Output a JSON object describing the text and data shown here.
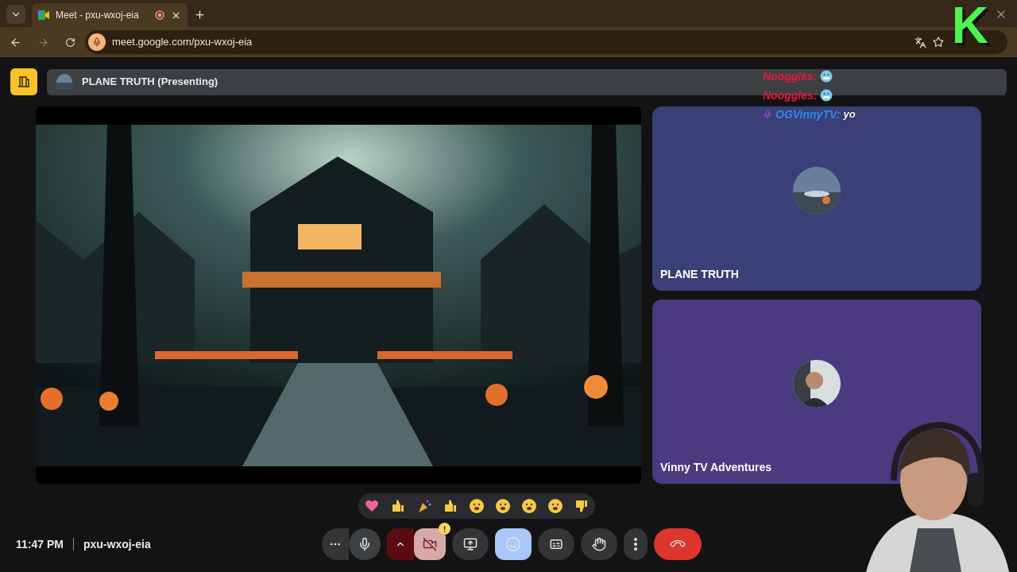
{
  "browser": {
    "tab": {
      "title": "Meet - pxu-wxoj-eia",
      "recording": true
    },
    "url": "meet.google.com/pxu-wxoj-eia"
  },
  "meeting": {
    "presenter_label": "PLANE TRUTH (Presenting)"
  },
  "tiles": [
    {
      "name": "PLANE TRUTH"
    },
    {
      "name": "Vinny TV Adventures"
    }
  ],
  "controls": {
    "camera": {
      "on": false,
      "warning": true
    },
    "reactions": {
      "selected": true
    }
  },
  "footer": {
    "clock": "11:47 PM",
    "meeting_code": "pxu-wxoj-eia"
  },
  "stream_overlay": {
    "logo": "K",
    "chat": [
      {
        "user": "Nooggles:",
        "color": "#e8173f",
        "kind": "emoji",
        "mic_badge": false
      },
      {
        "user": "Nooggles:",
        "color": "#e8173f",
        "kind": "emoji",
        "mic_badge": false
      },
      {
        "user": "OGVinnyTV:",
        "color": "#2f86f0",
        "kind": "text",
        "message": "yo",
        "mic_badge": true
      }
    ]
  }
}
